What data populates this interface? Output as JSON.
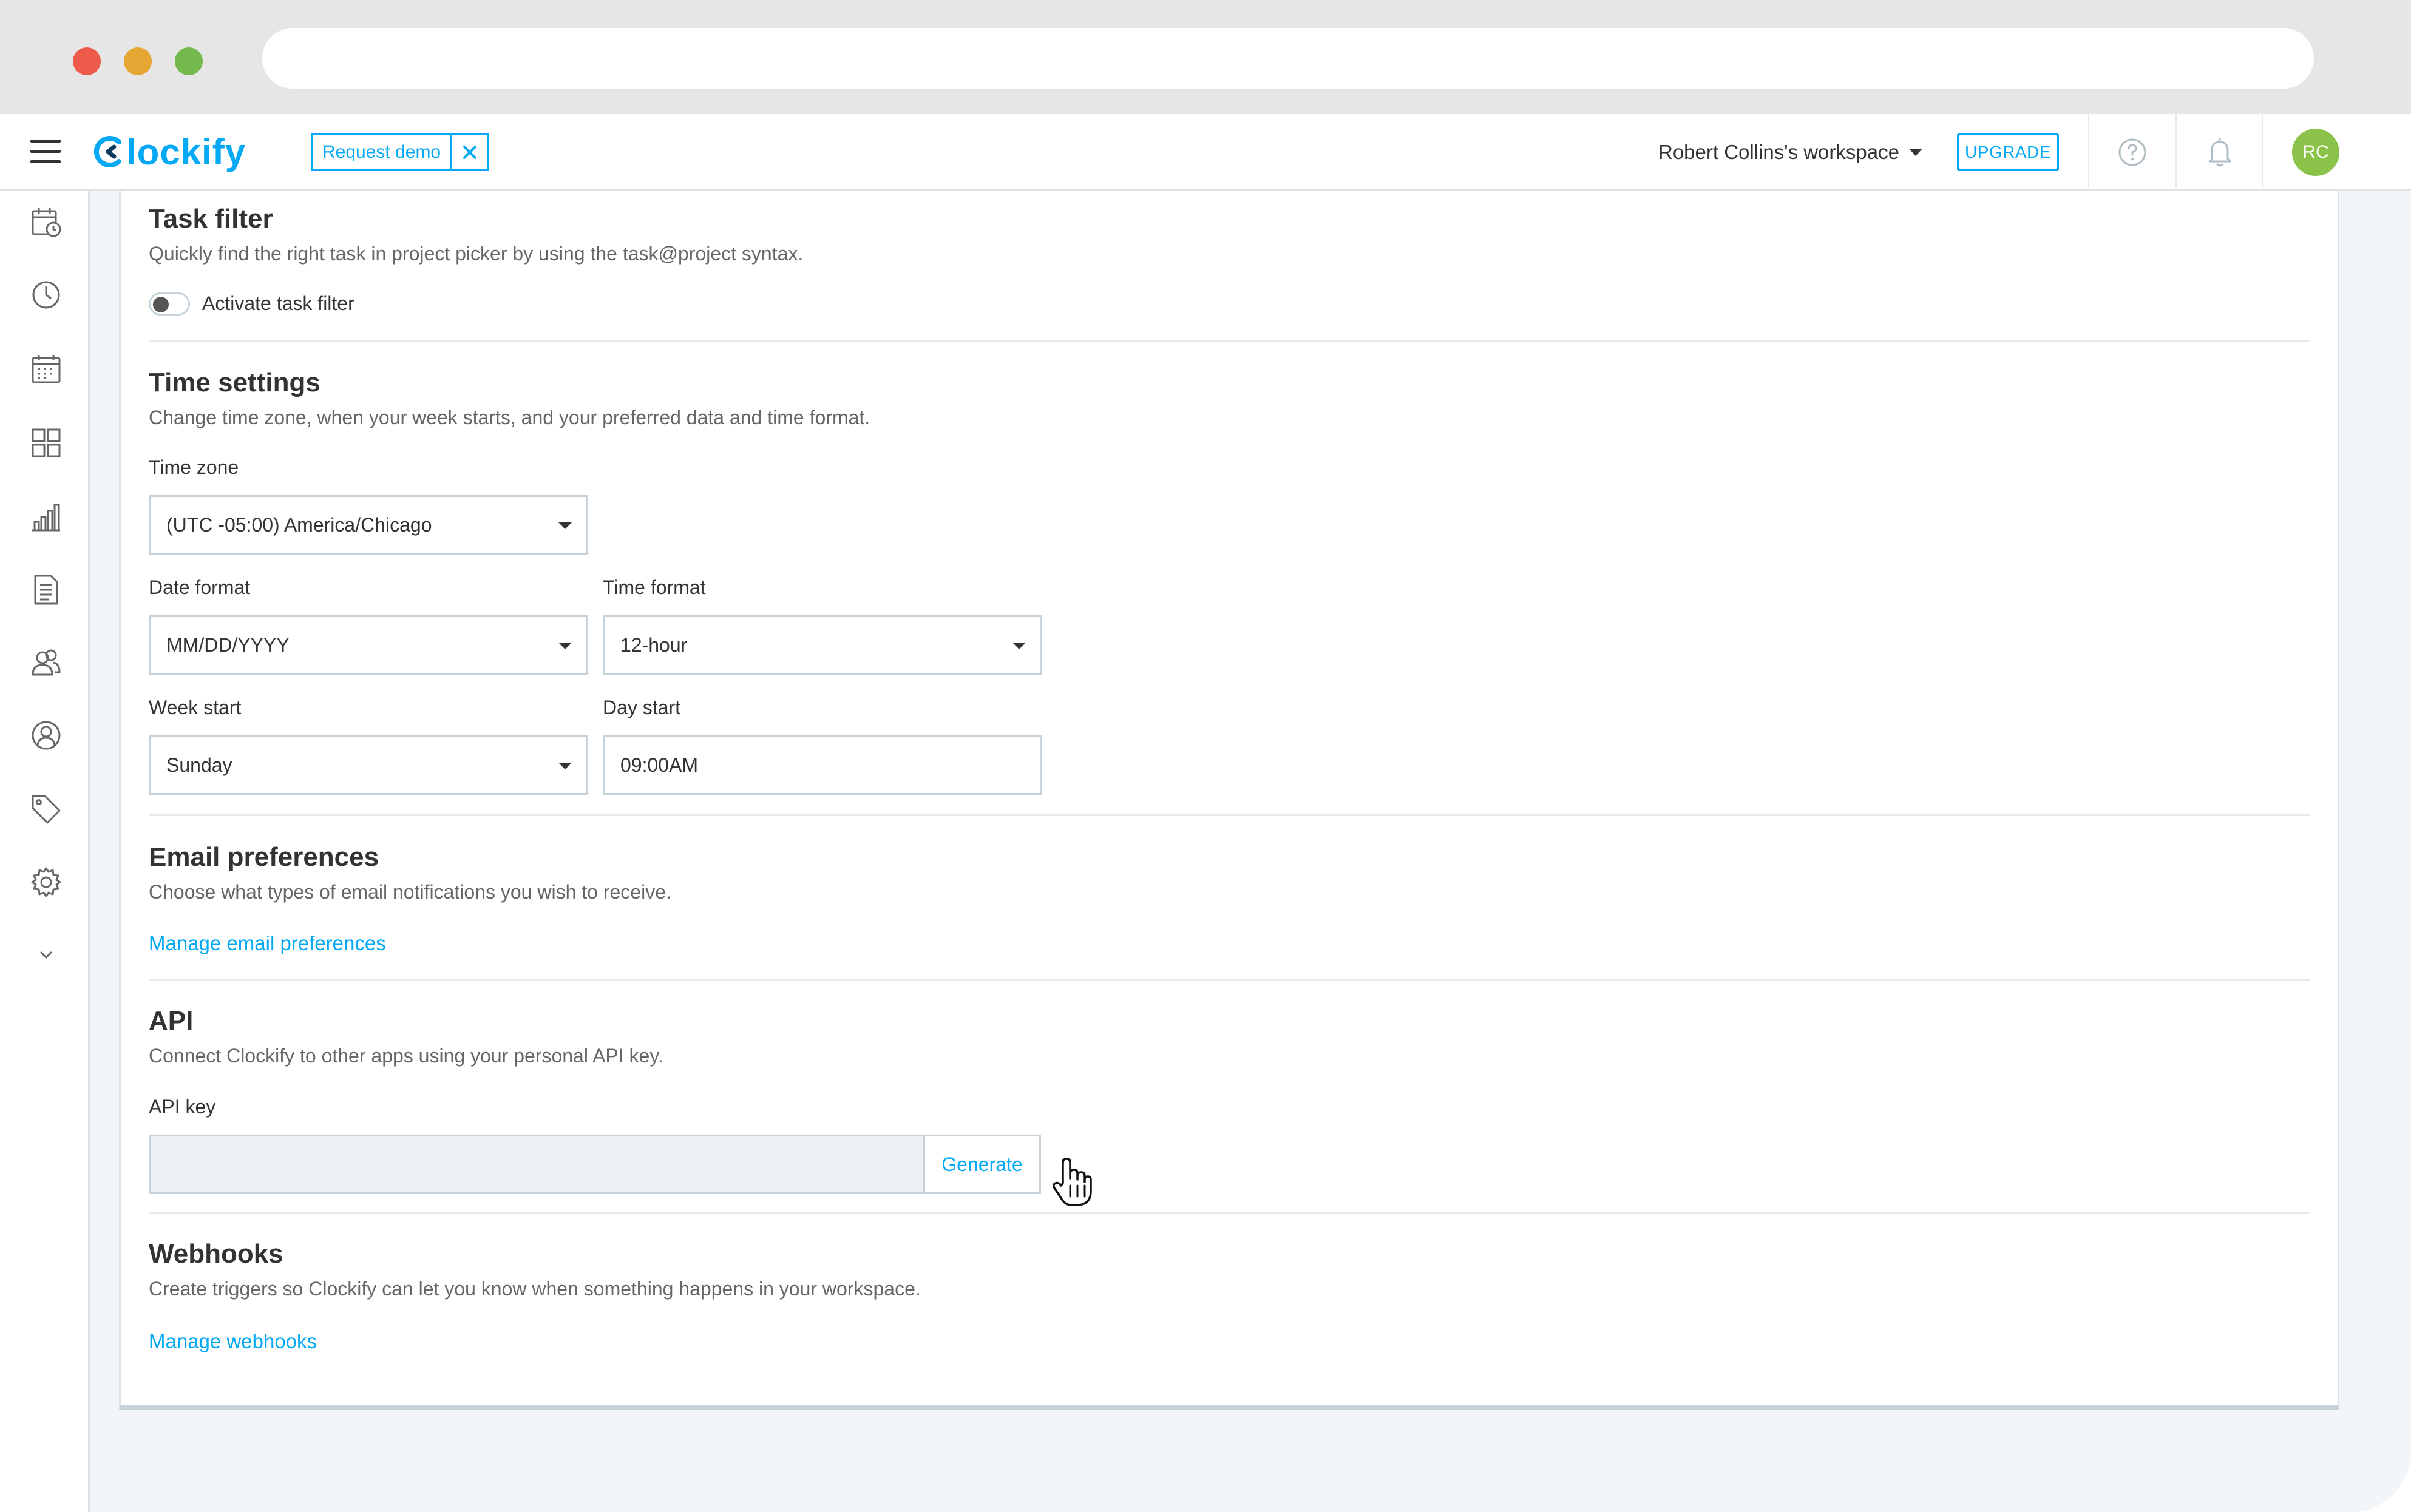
{
  "header": {
    "logo_text": "lockify",
    "request_demo_label": "Request demo",
    "workspace_label": "Robert Collins's workspace",
    "upgrade_label": "UPGRADE",
    "avatar_initials": "RC"
  },
  "colors": {
    "brand": "#03a9f4",
    "avatar": "#8bc34a",
    "page_bg": "#f2f6f8"
  },
  "sidebar": {
    "icons": [
      "calendar-clock-icon",
      "clock-icon",
      "calendar-icon",
      "dashboard-icon",
      "reports-icon",
      "document-icon",
      "team-icon",
      "client-icon",
      "tag-icon",
      "settings-icon",
      "chevron-down-icon"
    ]
  },
  "task_filter": {
    "title": "Task filter",
    "description": "Quickly find the right task in project picker by using the task@project syntax.",
    "toggle_label": "Activate task filter",
    "toggle_on": false
  },
  "time_settings": {
    "title": "Time settings",
    "description": "Change time zone, when your week starts, and your preferred data and time format.",
    "time_zone_label": "Time zone",
    "time_zone_value": "(UTC -05:00) America/Chicago",
    "date_format_label": "Date format",
    "date_format_value": "MM/DD/YYYY",
    "time_format_label": "Time format",
    "time_format_value": "12-hour",
    "week_start_label": "Week start",
    "week_start_value": "Sunday",
    "day_start_label": "Day start",
    "day_start_value": "09:00AM"
  },
  "email_preferences": {
    "title": "Email preferences",
    "description": "Choose what types of email notifications you wish to receive.",
    "link_label": "Manage email preferences"
  },
  "api": {
    "title": "API",
    "description": "Connect Clockify to other apps using your personal API key.",
    "key_label": "API key",
    "key_value": "",
    "generate_label": "Generate"
  },
  "webhooks": {
    "title": "Webhooks",
    "description": "Create triggers so Clockify can let you know when something happens in your workspace.",
    "link_label": "Manage webhooks"
  }
}
